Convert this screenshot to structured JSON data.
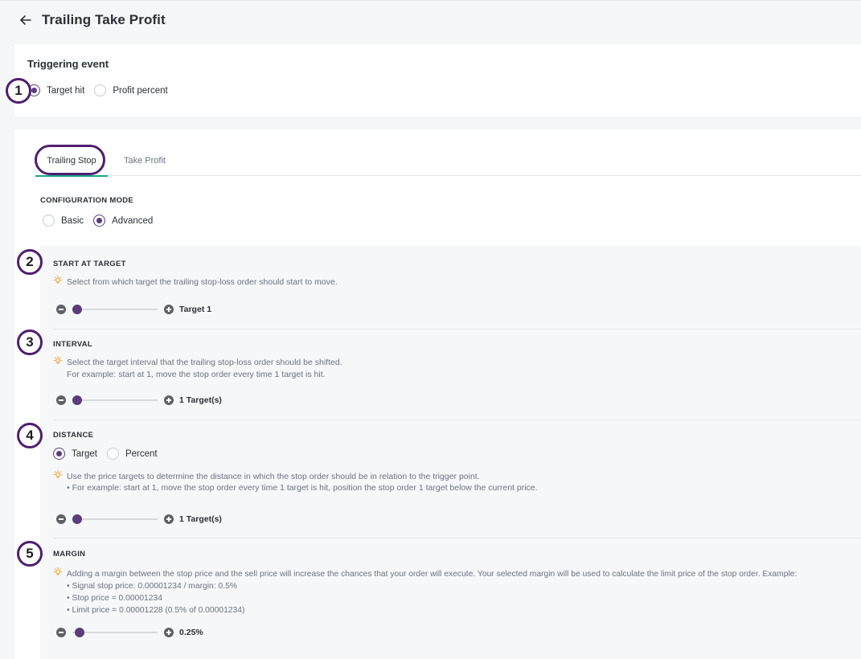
{
  "header": {
    "title": "Trailing Take Profit"
  },
  "trigger": {
    "title": "Triggering event",
    "options": [
      {
        "label": "Target hit",
        "checked": true
      },
      {
        "label": "Profit percent",
        "checked": false
      }
    ]
  },
  "markers": [
    "1",
    "2",
    "3",
    "4",
    "5"
  ],
  "tabs": [
    {
      "label": "Trailing Stop",
      "active": true
    },
    {
      "label": "Take Profit",
      "active": false
    }
  ],
  "config_mode": {
    "label": "CONFIGURATION MODE",
    "options": [
      {
        "label": "Basic",
        "checked": false
      },
      {
        "label": "Advanced",
        "checked": true
      }
    ]
  },
  "start_at_target": {
    "title": "START AT TARGET",
    "hint": "Select from which target the trailing stop-loss order should start to move.",
    "value_label": "Target 1",
    "slider_fraction": 0
  },
  "interval": {
    "title": "INTERVAL",
    "hint_lines": [
      "Select the target interval that the trailing stop-loss order should be shifted.",
      "For example: start at 1, move the stop order every time 1 target is hit."
    ],
    "value_label": "1 Target(s)",
    "slider_fraction": 0
  },
  "distance": {
    "title": "DISTANCE",
    "options": [
      {
        "label": "Target",
        "checked": true
      },
      {
        "label": "Percent",
        "checked": false
      }
    ],
    "hint_lines": [
      "Use the price targets to determine the distance in which the stop order should be in relation to the trigger point.",
      "• For example: start at 1, move the stop order every time 1 target is hit, position the stop order 1 target below the current price."
    ],
    "value_label": "1 Target(s)",
    "slider_fraction": 0
  },
  "margin": {
    "title": "MARGIN",
    "hint_lines": [
      "Adding a margin between the stop price and the sell price will increase the chances that your order will execute. Your selected margin will be used to calculate the limit price of the stop order. Example:",
      "• Signal stop price: 0.00001234 / margin: 0.5%",
      "• Stop price = 0.00001234",
      "• Limit price = 0.00001228 (0.5% of 0.00001234)"
    ],
    "value_label": "0.25%",
    "slider_fraction": 0.03
  },
  "colors": {
    "accent": "#5a3d7a",
    "tab_underline": "#1aa38b",
    "marker_ring": "#4f1f6e",
    "hint_icon": "#f0a030"
  },
  "icons": {
    "back": "arrow-left-icon",
    "hint": "lightbulb-icon",
    "minus": "minus-circle-icon",
    "plus": "plus-circle-icon"
  }
}
